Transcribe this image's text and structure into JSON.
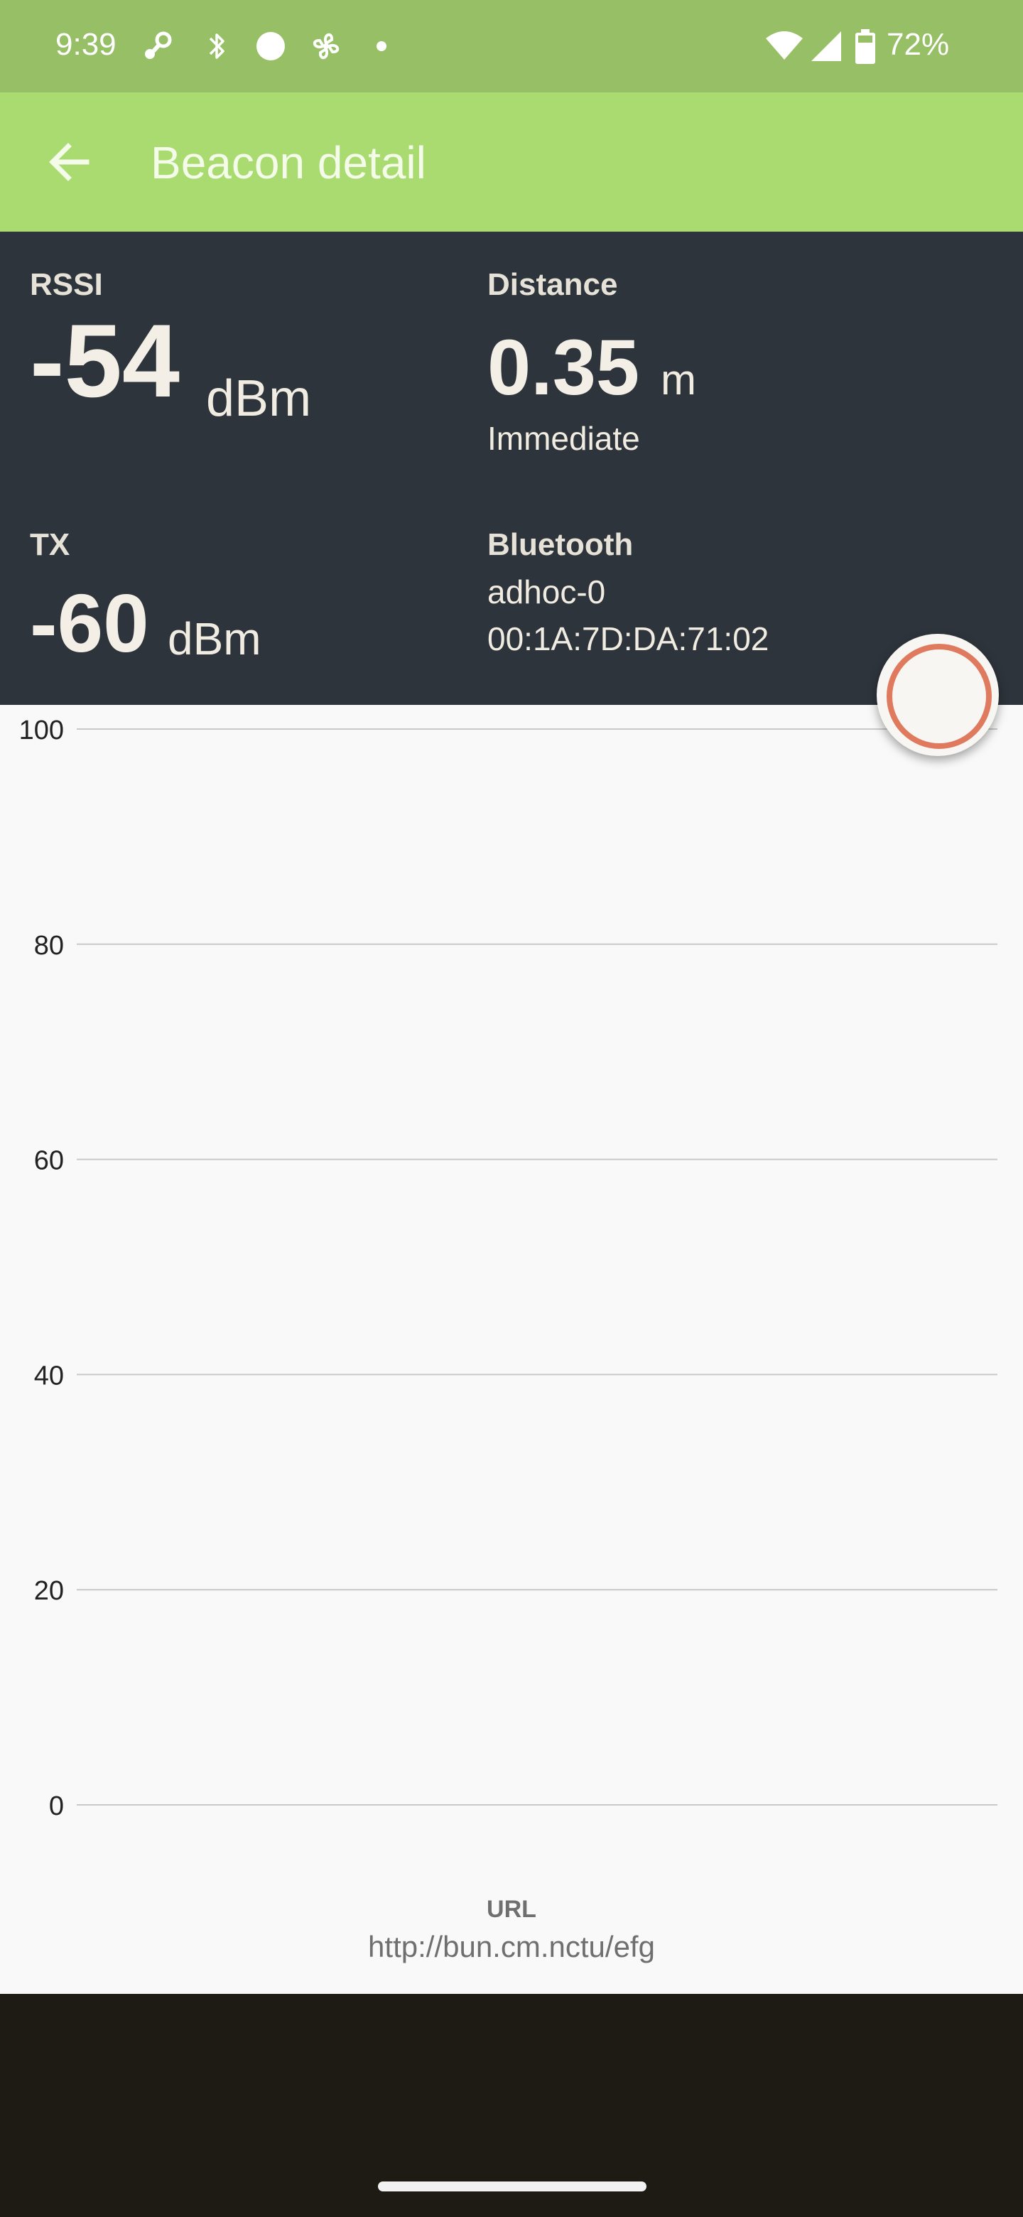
{
  "status_bar": {
    "time": "9:39",
    "battery_percent": "72%",
    "icons": [
      "steam-icon",
      "bluetooth-icon",
      "dot-icon",
      "fan-icon",
      "small-dot-icon",
      "wifi-icon",
      "signal-icon",
      "battery-icon"
    ]
  },
  "app_bar": {
    "back_icon": "arrow-left-icon",
    "title": "Beacon detail"
  },
  "beacon": {
    "rssi": {
      "label": "RSSI",
      "value": "-54",
      "unit": "dBm"
    },
    "distance": {
      "label": "Distance",
      "value": "0.35",
      "unit": "m",
      "proximity": "Immediate"
    },
    "tx": {
      "label": "TX",
      "value": "-60",
      "unit": "dBm"
    },
    "bluetooth": {
      "label": "Bluetooth",
      "name": "adhoc-0",
      "address": "00:1A:7D:DA:71:02"
    }
  },
  "fab": {
    "icon": "record-icon"
  },
  "chart_data": {
    "type": "line",
    "title": "",
    "xlabel": "",
    "ylabel": "",
    "ylim": [
      0,
      100
    ],
    "y_ticks": [
      100,
      80,
      60,
      40,
      20,
      0
    ],
    "y_tick_labels": [
      "100",
      "80",
      "60",
      "40",
      "20",
      "0"
    ],
    "grid": true,
    "series": []
  },
  "url": {
    "label": "URL",
    "value": "http://bun.cm.nctu/efg"
  },
  "colors": {
    "status_bar": "#97bf66",
    "app_bar": "#a9db71",
    "info_panel": "#2e343b",
    "fab_ring": "#e07a5f",
    "chart_background": "#f9f9f9"
  }
}
